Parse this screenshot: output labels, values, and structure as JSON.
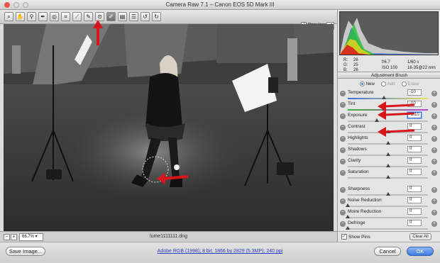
{
  "window": {
    "title": "Camera Raw 7.1  –  Canon EOS 5D Mark III",
    "preview_label": "Preview",
    "filename": "lume1111111.dng",
    "zoom": "66.7%"
  },
  "info": {
    "r_label": "R:",
    "r_value": "26",
    "g_label": "G:",
    "g_value": "25",
    "b_label": "B:",
    "b_value": "26",
    "aperture": "f/6.7",
    "shutter": "1/60 s",
    "iso": "ISO 100",
    "lens": "16-35@22 mm"
  },
  "panel": {
    "title": "Adjustment Brush",
    "modes": [
      "New",
      "Add",
      "Erase"
    ],
    "selected_mode": "New"
  },
  "sliders": [
    {
      "label": "Temperature",
      "value": "-10",
      "knob": 0.45
    },
    {
      "label": "Tint",
      "value": "-10",
      "knob": 0.45
    },
    {
      "label": "Exposure",
      "value": "-1.10",
      "knob": 0.36
    },
    {
      "label": "Contrast",
      "value": "0",
      "knob": 0.5
    },
    {
      "label": "Highlights",
      "value": "0",
      "knob": 0.5
    },
    {
      "label": "Shadows",
      "value": "0",
      "knob": 0.5
    },
    {
      "label": "Clarity",
      "value": "0",
      "knob": 0.5
    },
    {
      "label": "Saturation",
      "value": "0",
      "knob": 0.5
    },
    {
      "label": "Sharpness",
      "value": "0",
      "knob": 0.5
    },
    {
      "label": "Noise Reduction",
      "value": "0",
      "knob": 0.0
    },
    {
      "label": "Moire Reduction",
      "value": "0",
      "knob": 0.0
    },
    {
      "label": "Defringe",
      "value": "0",
      "knob": 0.0
    }
  ],
  "bottom": {
    "show_pins_label": "Show Pins",
    "clear_all_label": "Clear All"
  },
  "footer": {
    "save_label": "Save Image...",
    "workflow": "Adobe RGB (1998); 8 bit; 1866 by 2829 (5.3MP); 240 ppi",
    "cancel_label": "Cancel",
    "ok_label": "OK"
  },
  "colors": {
    "accent": "#3b79e0",
    "annotation_arrow": "#d9161c"
  },
  "icons": {
    "zoom": "zoom-icon",
    "hand": "hand-icon",
    "wb": "white-balance-icon",
    "sampler": "color-sampler-icon",
    "target": "targeted-adjust-icon",
    "crop": "crop-icon",
    "straighten": "straighten-icon",
    "spot": "spot-removal-icon",
    "redeye": "red-eye-icon",
    "brush": "adjustment-brush-icon",
    "grad": "graduated-filter-icon",
    "prefs": "preferences-icon",
    "rotl": "rotate-left-icon",
    "rotr": "rotate-right-icon"
  }
}
